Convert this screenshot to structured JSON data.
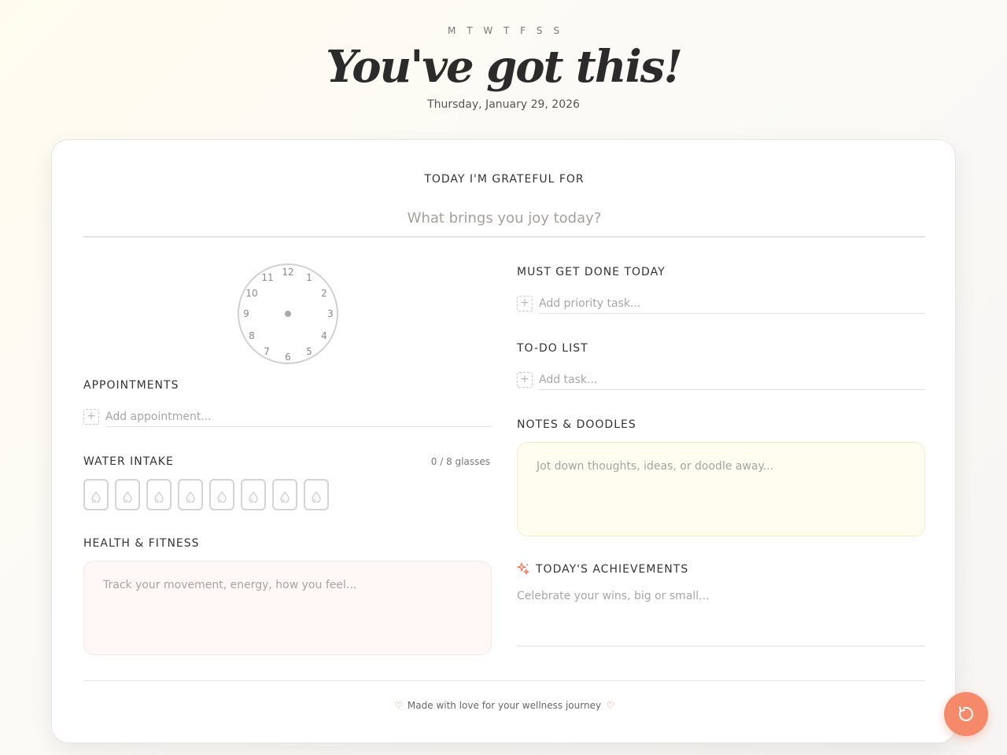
{
  "header": {
    "weekdays": "M T W T F S S",
    "title": "You've got this!",
    "date": "Thursday, January 29, 2026"
  },
  "gratitude": {
    "label": "TODAY I'M GRATEFUL FOR",
    "placeholder": "What brings you joy today?"
  },
  "clock": {
    "numbers": [
      "12",
      "1",
      "2",
      "3",
      "4",
      "5",
      "6",
      "7",
      "8",
      "9",
      "10",
      "11"
    ]
  },
  "appointments": {
    "label": "APPOINTMENTS",
    "placeholder": "Add appointment..."
  },
  "water": {
    "label": "WATER INTAKE",
    "count_text": "0 / 8 glasses",
    "glasses": 8,
    "filled": 0
  },
  "health": {
    "label": "HEALTH & FITNESS",
    "placeholder": "Track your movement, energy, how you feel..."
  },
  "priority": {
    "label": "MUST GET DONE TODAY",
    "placeholder": "Add priority task..."
  },
  "todo": {
    "label": "TO-DO LIST",
    "placeholder": "Add task..."
  },
  "notes": {
    "label": "NOTES & DOODLES",
    "placeholder": "Jot down thoughts, ideas, or doodle away..."
  },
  "achievements": {
    "label": "TODAY'S ACHIEVEMENTS",
    "icon": "sparkles-icon",
    "placeholder": "Celebrate your wins, big or small..."
  },
  "footer": {
    "text": "Made with love for your wellness journey",
    "icon": "heart-icon"
  },
  "fab": {
    "icon": "refresh-icon"
  },
  "colors": {
    "accent": "#f48a6a",
    "health_bg": "#fff8f6",
    "notes_bg": "#fffdf0"
  }
}
